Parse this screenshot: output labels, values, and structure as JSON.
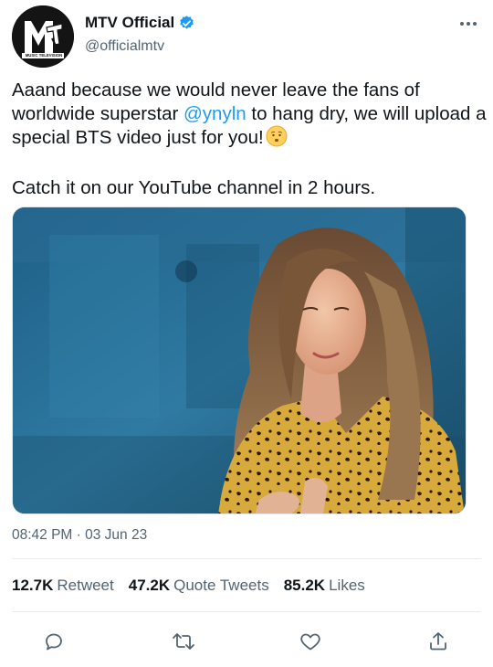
{
  "account": {
    "display_name": "MTV Official",
    "handle": "@officialmtv",
    "verified": true,
    "avatar_text": "MUSIC TELEVISION"
  },
  "tweet": {
    "line1_before": "Aaand because we would never leave the fans of worldwide superstar ",
    "mention": "@ynyln",
    "line1_after": " to hang dry, we will upload a special BTS video just for you!",
    "emoji": "hushed-face-emoji",
    "line2": "Catch it on our YouTube channel in 2 hours."
  },
  "timestamp": "08:42 PM · 03 Jun 23",
  "stats": {
    "retweets": "12.7K",
    "retweets_label": "Retweet",
    "quotes": "47.2K",
    "quotes_label": "Quote Tweets",
    "likes": "85.2K",
    "likes_label": "Likes"
  },
  "icons": {
    "reply": "reply-icon",
    "retweet": "retweet-icon",
    "like": "heart-icon",
    "share": "share-icon",
    "more": "more-icon"
  },
  "colors": {
    "accent": "#1d9bf0",
    "text": "#0f1419",
    "secondary": "#536471",
    "verified": "#1d9bf0"
  }
}
